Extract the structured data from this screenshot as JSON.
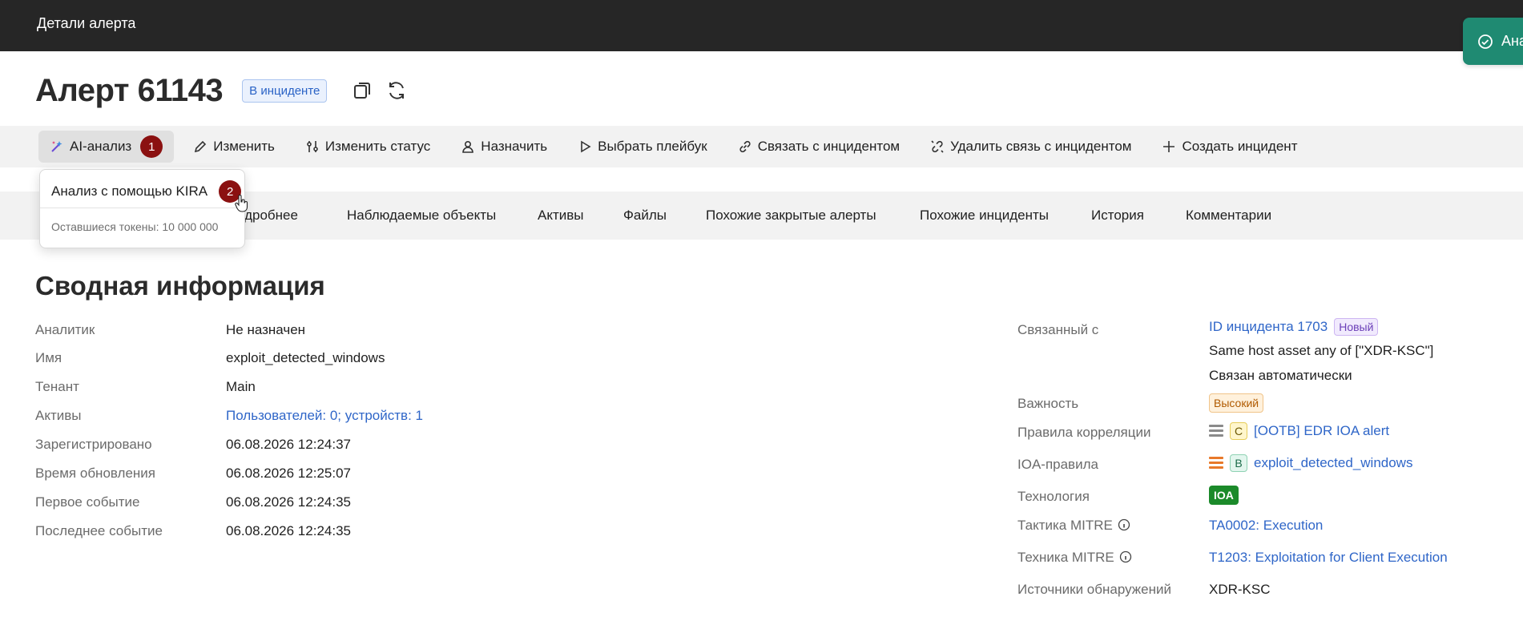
{
  "topbar": {
    "title": "Детали алерта"
  },
  "toast": {
    "text": "Ана",
    "icon": "check-circle-icon"
  },
  "header": {
    "title": "Алерт 61143",
    "badge": "В инциденте",
    "icons": [
      "copy-icon",
      "refresh-icon"
    ]
  },
  "toolbar": {
    "items": [
      {
        "label": "AI-анализ",
        "icon": "ai-sparkle-icon",
        "step": "1"
      },
      {
        "label": "Изменить",
        "icon": "pencil-icon"
      },
      {
        "label": "Изменить статус",
        "icon": "sliders-icon"
      },
      {
        "label": "Назначить",
        "icon": "user-icon"
      },
      {
        "label": "Выбрать плейбук",
        "icon": "play-icon"
      },
      {
        "label": "Связать с инцидентом",
        "icon": "link-icon"
      },
      {
        "label": "Удалить связь с инцидентом",
        "icon": "unlink-icon"
      },
      {
        "label": "Создать инцидент",
        "icon": "plus-icon"
      }
    ]
  },
  "dropdown": {
    "item": "Анализ с помощью KIRA",
    "step": "2",
    "tokens": "Оставшиеся токены: 10 000 000"
  },
  "tabs": [
    "одробнее",
    "Наблюдаемые объекты",
    "Активы",
    "Файлы",
    "Похожие закрытые алерты",
    "Похожие инциденты",
    "История",
    "Комментарии"
  ],
  "summary": {
    "title": "Сводная информация",
    "left": [
      {
        "label": "Аналитик",
        "value": "Не назначен"
      },
      {
        "label": "Имя",
        "value": "exploit_detected_windows"
      },
      {
        "label": "Тенант",
        "value": "Main"
      },
      {
        "label": "Активы",
        "value": "Пользователей: 0; устройств: 1"
      },
      {
        "label": "Зарегистрировано",
        "value": "06.08.2026 12:24:37"
      },
      {
        "label": "Время обновления",
        "value": "06.08.2026 12:25:07"
      },
      {
        "label": "Первое событие",
        "value": "06.08.2026 12:24:35"
      },
      {
        "label": "Последнее событие",
        "value": "06.08.2026 12:24:35"
      }
    ],
    "right": {
      "related_label": "Связанный с",
      "related_link": "ID инцидента 1703",
      "related_badge": "Новый",
      "related_line2": "Same host asset any of [\"XDR-KSC\"]",
      "related_line3": "Связан автоматически",
      "severity_label": "Важность",
      "severity": "Высокий",
      "correlation_label": "Правила корреляции",
      "correlation_letter": "C",
      "correlation_link": "[OOTB] EDR IOA alert",
      "ioa_label": "IOA-правила",
      "ioa_letter": "B",
      "ioa_link": "exploit_detected_windows",
      "tech_label": "Технология",
      "tech": "IOA",
      "tactic_label": "Тактика MITRE",
      "tactic": "TA0002: Execution",
      "technique_label": "Техника MITRE",
      "technique": "T1203: Exploitation for Client Execution",
      "sources_label": "Источники обнаружений",
      "sources": "XDR-KSC"
    }
  },
  "colors": {
    "accent_link": "#2f66c8",
    "step_badge": "#8b1111",
    "toast": "#1f8a72",
    "topbar": "#262626"
  }
}
